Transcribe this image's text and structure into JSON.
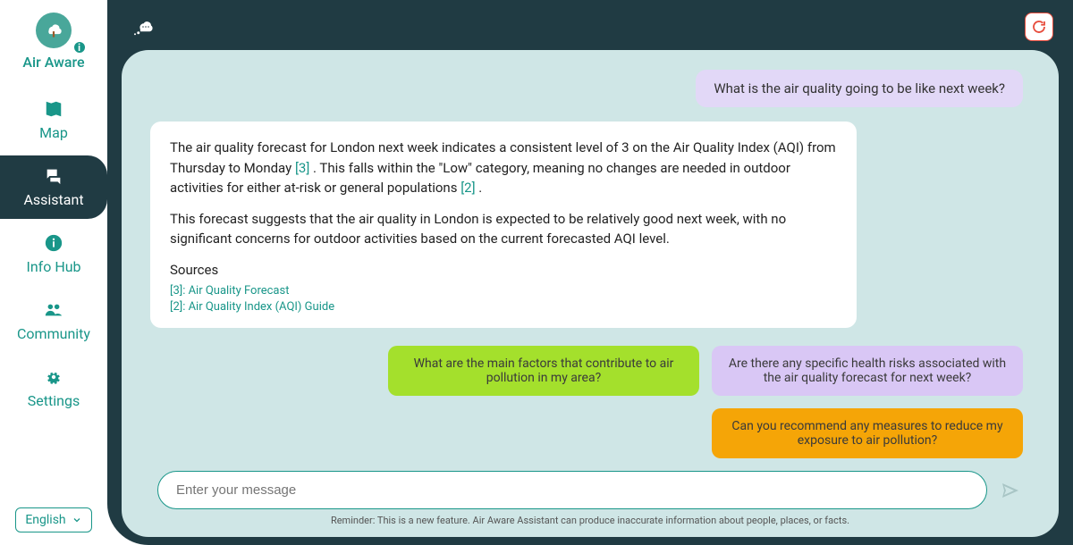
{
  "brand": "Air Aware",
  "nav": {
    "map": "Map",
    "assistant": "Assistant",
    "info_hub": "Info Hub",
    "community": "Community",
    "settings": "Settings"
  },
  "language": "English",
  "conversation": {
    "user_q": "What is the air quality going to be like next week?",
    "bot_p1a": "The air quality forecast for London next week indicates a consistent level of 3 on the Air Quality Index (AQI) from Thursday to Monday ",
    "bot_cite_3": "[3]",
    "bot_p1b": " . This falls within the \"Low\" category, meaning no changes are needed in outdoor activities for either at-risk or general populations ",
    "bot_cite_2": "[2]",
    "bot_p1c": " .",
    "bot_p2": "This forecast suggests that the air quality in London is expected to be relatively good next week, with no significant concerns for outdoor activities based on the current forecasted AQI level.",
    "sources_heading": "Sources",
    "source_3": "[3]: Air Quality Forecast",
    "source_2": "[2]: Air Quality Index (AQI) Guide"
  },
  "suggestions": {
    "s1": "What are the main factors that contribute to air pollution in my area?",
    "s2": "Are there any specific health risks associated with the air quality forecast for next week?",
    "s3": "Can you recommend any measures to reduce my exposure to air pollution?"
  },
  "input": {
    "placeholder": "Enter your message"
  },
  "disclaimer": "Reminder: This is a new feature. Air Aware Assistant can produce inaccurate information about people, places, or facts."
}
